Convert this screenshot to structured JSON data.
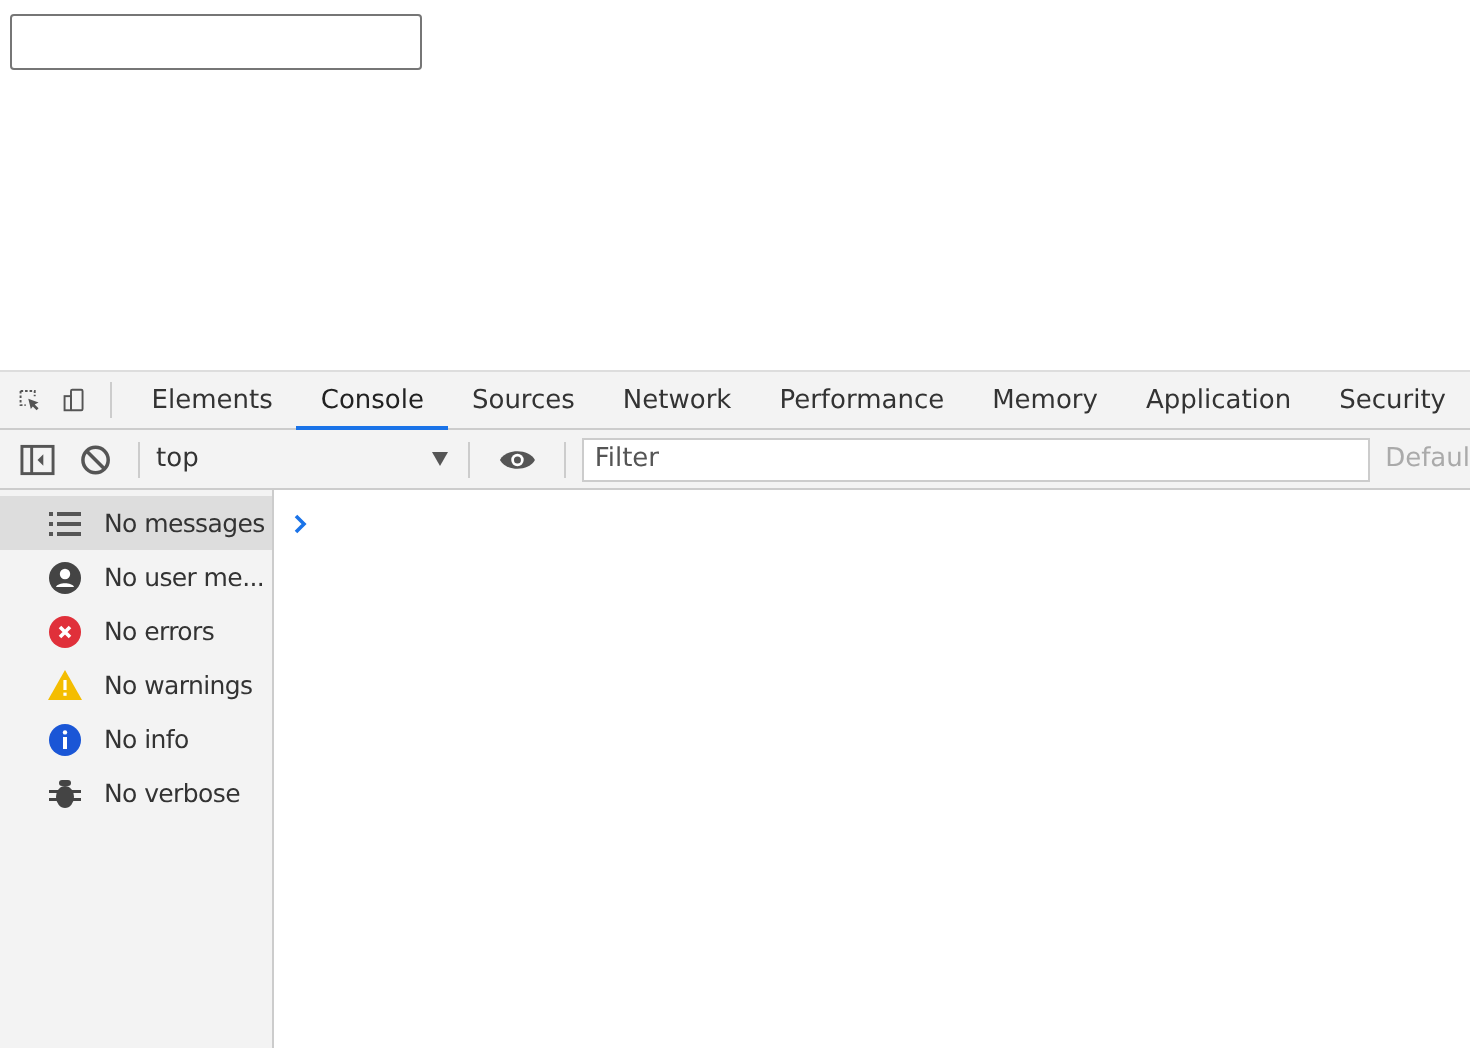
{
  "devtools": {
    "tabs": [
      {
        "label": "Elements",
        "selected": false
      },
      {
        "label": "Console",
        "selected": true
      },
      {
        "label": "Sources",
        "selected": false
      },
      {
        "label": "Network",
        "selected": false
      },
      {
        "label": "Performance",
        "selected": false
      },
      {
        "label": "Memory",
        "selected": false
      },
      {
        "label": "Application",
        "selected": false
      },
      {
        "label": "Security",
        "selected": false
      }
    ],
    "toolbar": {
      "context": "top",
      "filter": {
        "placeholder": "Filter"
      },
      "levels": "Defaul"
    },
    "sidebar": [
      {
        "kind": "messages",
        "label": "No messages",
        "selected": true
      },
      {
        "kind": "user",
        "label": "No user me...",
        "selected": false
      },
      {
        "kind": "errors",
        "label": "No errors",
        "selected": false
      },
      {
        "kind": "warnings",
        "label": "No warnings",
        "selected": false
      },
      {
        "kind": "info",
        "label": "No info",
        "selected": false
      },
      {
        "kind": "verbose",
        "label": "No verbose",
        "selected": false
      }
    ]
  }
}
